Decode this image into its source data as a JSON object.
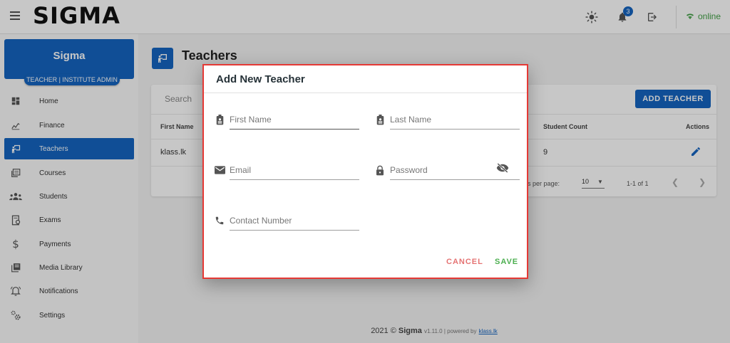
{
  "app": {
    "brand": "SIGMA",
    "notification_count": "3",
    "status": "online"
  },
  "sidebar": {
    "profile_name": "Sigma",
    "profile_role": "TEACHER | INSTITUTE ADMIN",
    "items": [
      {
        "label": "Home",
        "icon": "dashboard-icon"
      },
      {
        "label": "Finance",
        "icon": "finance-chart-icon"
      },
      {
        "label": "Teachers",
        "icon": "teacher-board-icon",
        "active": true
      },
      {
        "label": "Courses",
        "icon": "courses-icon"
      },
      {
        "label": "Students",
        "icon": "students-group-icon"
      },
      {
        "label": "Exams",
        "icon": "exams-icon"
      },
      {
        "label": "Payments",
        "icon": "dollar-icon"
      },
      {
        "label": "Media Library",
        "icon": "media-library-icon"
      },
      {
        "label": "Notifications",
        "icon": "bell-outline-icon"
      },
      {
        "label": "Settings",
        "icon": "gears-icon"
      }
    ]
  },
  "page": {
    "title": "Teachers"
  },
  "table": {
    "search_label": "Search",
    "add_button": "ADD TEACHER",
    "headers": {
      "first_name": "First Name",
      "student_count": "Student Count",
      "actions": "Actions"
    },
    "rows": [
      {
        "first_name": "klass.lk",
        "student_count": "9"
      }
    ],
    "footer": {
      "rows_per_page_label": "Rows per page:",
      "rows_per_page_value": "10",
      "range": "1-1 of 1"
    }
  },
  "footer": {
    "copyright": "2021 ©",
    "brand": "Sigma",
    "version": "v1.11.0 | powered by",
    "link": "klass.lk"
  },
  "dialog": {
    "title": "Add New Teacher",
    "fields": {
      "first_name": "First Name",
      "last_name": "Last Name",
      "email": "Email",
      "password": "Password",
      "contact": "Contact Number"
    },
    "cancel": "CANCEL",
    "save": "SAVE"
  },
  "colors": {
    "primary": "#1565c0",
    "dialog_border": "#e53935",
    "online": "#43a047",
    "save": "#4caf50",
    "cancel": "#e57373"
  }
}
